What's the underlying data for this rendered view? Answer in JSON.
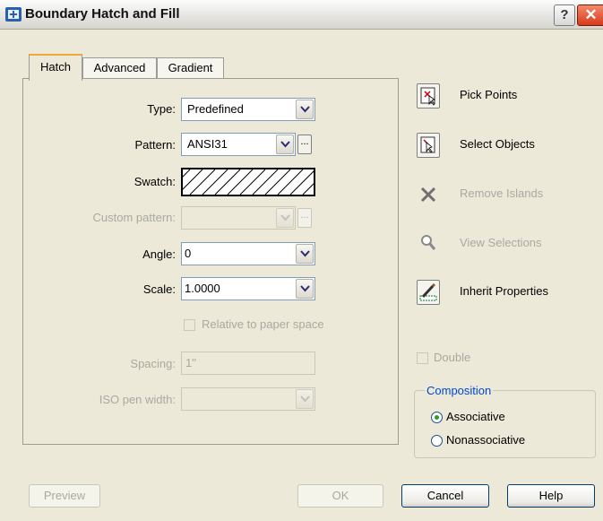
{
  "window": {
    "title": "Boundary Hatch and Fill",
    "help_label": "?",
    "close_label": "✕"
  },
  "tabs": [
    {
      "label": "Hatch"
    },
    {
      "label": "Advanced"
    },
    {
      "label": "Gradient"
    }
  ],
  "hatch": {
    "type_label": "Type:",
    "type_value": "Predefined",
    "pattern_label": "Pattern:",
    "pattern_value": "ANSI31",
    "browse_label": "...",
    "swatch_label": "Swatch:",
    "custom_label": "Custom pattern:",
    "custom_value": "",
    "angle_label": "Angle:",
    "angle_value": "0",
    "scale_label": "Scale:",
    "scale_value": "1.0000",
    "relative_label": "Relative to paper space",
    "spacing_label": "Spacing:",
    "spacing_value": "1\"",
    "iso_label": "ISO pen width:",
    "iso_value": ""
  },
  "side": {
    "pick_points": "Pick Points",
    "select_objects": "Select Objects",
    "remove_islands": "Remove Islands",
    "view_selections": "View Selections",
    "inherit_properties": "Inherit Properties",
    "double_label": "Double",
    "composition_title": "Composition",
    "associative_label": "Associative",
    "nonassociative_label": "Nonassociative",
    "selected": "Associative"
  },
  "footer": {
    "preview": "Preview",
    "ok": "OK",
    "cancel": "Cancel",
    "help": "Help"
  }
}
